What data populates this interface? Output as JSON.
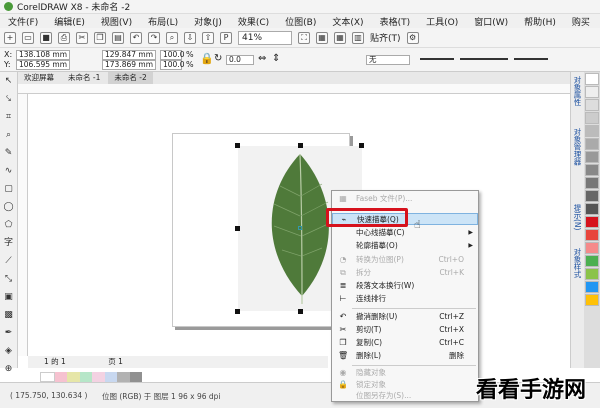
{
  "window": {
    "title": "CorelDRAW X8 - 未命名 -2"
  },
  "menu": [
    "文件(F)",
    "编辑(E)",
    "视图(V)",
    "布局(L)",
    "对象(J)",
    "效果(C)",
    "位图(B)",
    "文本(X)",
    "表格(T)",
    "工具(O)",
    "窗口(W)",
    "帮助(H)",
    "购买"
  ],
  "toolbar": {
    "zoom": "41%",
    "snap": "贴齐(T)"
  },
  "propbar": {
    "x": "138.108 mm",
    "y": "106.595 mm",
    "w": "129.847 mm",
    "h": "173.869 mm",
    "sx": "100.0",
    "sy": "100.0",
    "pct": "%",
    "angle": "0.0",
    "outline": "无"
  },
  "tabs": [
    "欢迎屏幕",
    "未命名 -1",
    "未命名 -2"
  ],
  "dock": [
    "对象属性",
    "对象管理器",
    "提示(N)",
    "对象样式"
  ],
  "pagebar": {
    "nav": "1 的 1",
    "page": "页 1"
  },
  "status": {
    "coords": "( 175.750, 130.634 )",
    "info": "位图 (RGB) 于 图层 1 96 x 96 dpi"
  },
  "context_menu": [
    {
      "label": "Faseb 文件(P)...",
      "disabled": true
    },
    {
      "label": "快速描摹(Q)",
      "highlight": true
    },
    {
      "label": "中心线描摹(C)",
      "sub": true
    },
    {
      "label": "轮廓描摹(O)",
      "sub": true
    },
    {
      "label": "转换为位图(P)",
      "sc": "Ctrl+O",
      "disabled": true
    },
    {
      "label": "拆分",
      "sc": "Ctrl+K",
      "disabled": true
    },
    {
      "label": "段落文本换行(W)"
    },
    {
      "label": "连线排行"
    },
    {
      "label": "撤消删除(U)",
      "sc": "Ctrl+Z",
      "sep": true
    },
    {
      "label": "剪切(T)",
      "sc": "Ctrl+X"
    },
    {
      "label": "复制(C)",
      "sc": "Ctrl+C"
    },
    {
      "label": "删除(L)",
      "sc": "删除"
    },
    {
      "label": "隐藏对象",
      "sep": true,
      "disabled": true
    },
    {
      "label": "锁定对象",
      "disabled": true
    },
    {
      "label": "位图另存为(S)...",
      "disabled": true
    }
  ],
  "watermark": "看看手游网",
  "colors": {
    "red_box": "#d6121d",
    "leaf": "#4f7a3a",
    "selection": "#cce4f7"
  }
}
